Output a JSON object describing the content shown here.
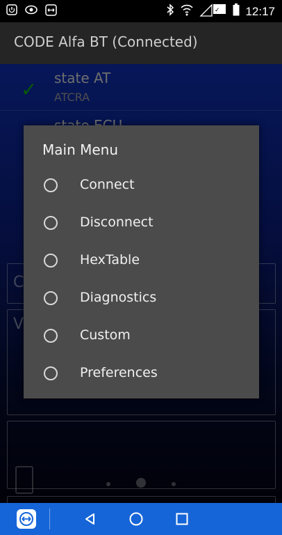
{
  "status_bar": {
    "time": "12:17",
    "icons_left": [
      "power-icon",
      "eye-icon",
      "teamviewer-icon"
    ],
    "icons_right": [
      "bluetooth-icon",
      "wifi-icon",
      "signal-icon",
      "battery-icon"
    ]
  },
  "app_bar": {
    "title": "CODE Alfa BT (Connected)"
  },
  "background_list": {
    "items": [
      {
        "title": "state AT",
        "subtitle": "ATCRA"
      },
      {
        "title": "state ECU"
      }
    ],
    "field_letter_1": "C",
    "field_letter_2": "V"
  },
  "dialog": {
    "title": "Main Menu",
    "options": [
      {
        "label": "Connect",
        "selected": false
      },
      {
        "label": "Disconnect",
        "selected": false
      },
      {
        "label": "HexTable",
        "selected": false
      },
      {
        "label": "Diagnostics",
        "selected": false
      },
      {
        "label": "Custom",
        "selected": false
      },
      {
        "label": "Preferences",
        "selected": false
      }
    ]
  },
  "colors": {
    "app_bar": "#252525",
    "dialog": "#4b4b4b",
    "nav_bar": "#1665d8",
    "check": "#10a010"
  }
}
